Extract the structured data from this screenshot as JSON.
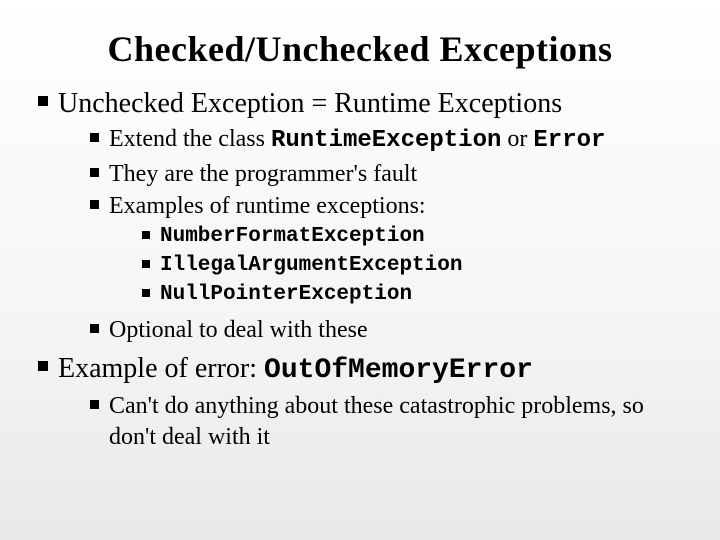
{
  "title": "Checked/Unchecked Exceptions",
  "b1": {
    "text": "Unchecked Exception = Runtime Exceptions",
    "sub": {
      "s1_pre": "Extend the class ",
      "s1_code1": "RuntimeException",
      "s1_mid": " or ",
      "s1_code2": "Error",
      "s2": "They are the programmer's fault",
      "s3": "Examples of runtime exceptions:",
      "ex1": "NumberFormatException",
      "ex2": "IllegalArgumentException",
      "ex3": "NullPointerException",
      "s4": "Optional to deal with these"
    }
  },
  "b2": {
    "pre": "Example of error: ",
    "code": "OutOfMemoryError",
    "sub": "Can't do anything about these catastrophic problems, so don't deal with it"
  }
}
